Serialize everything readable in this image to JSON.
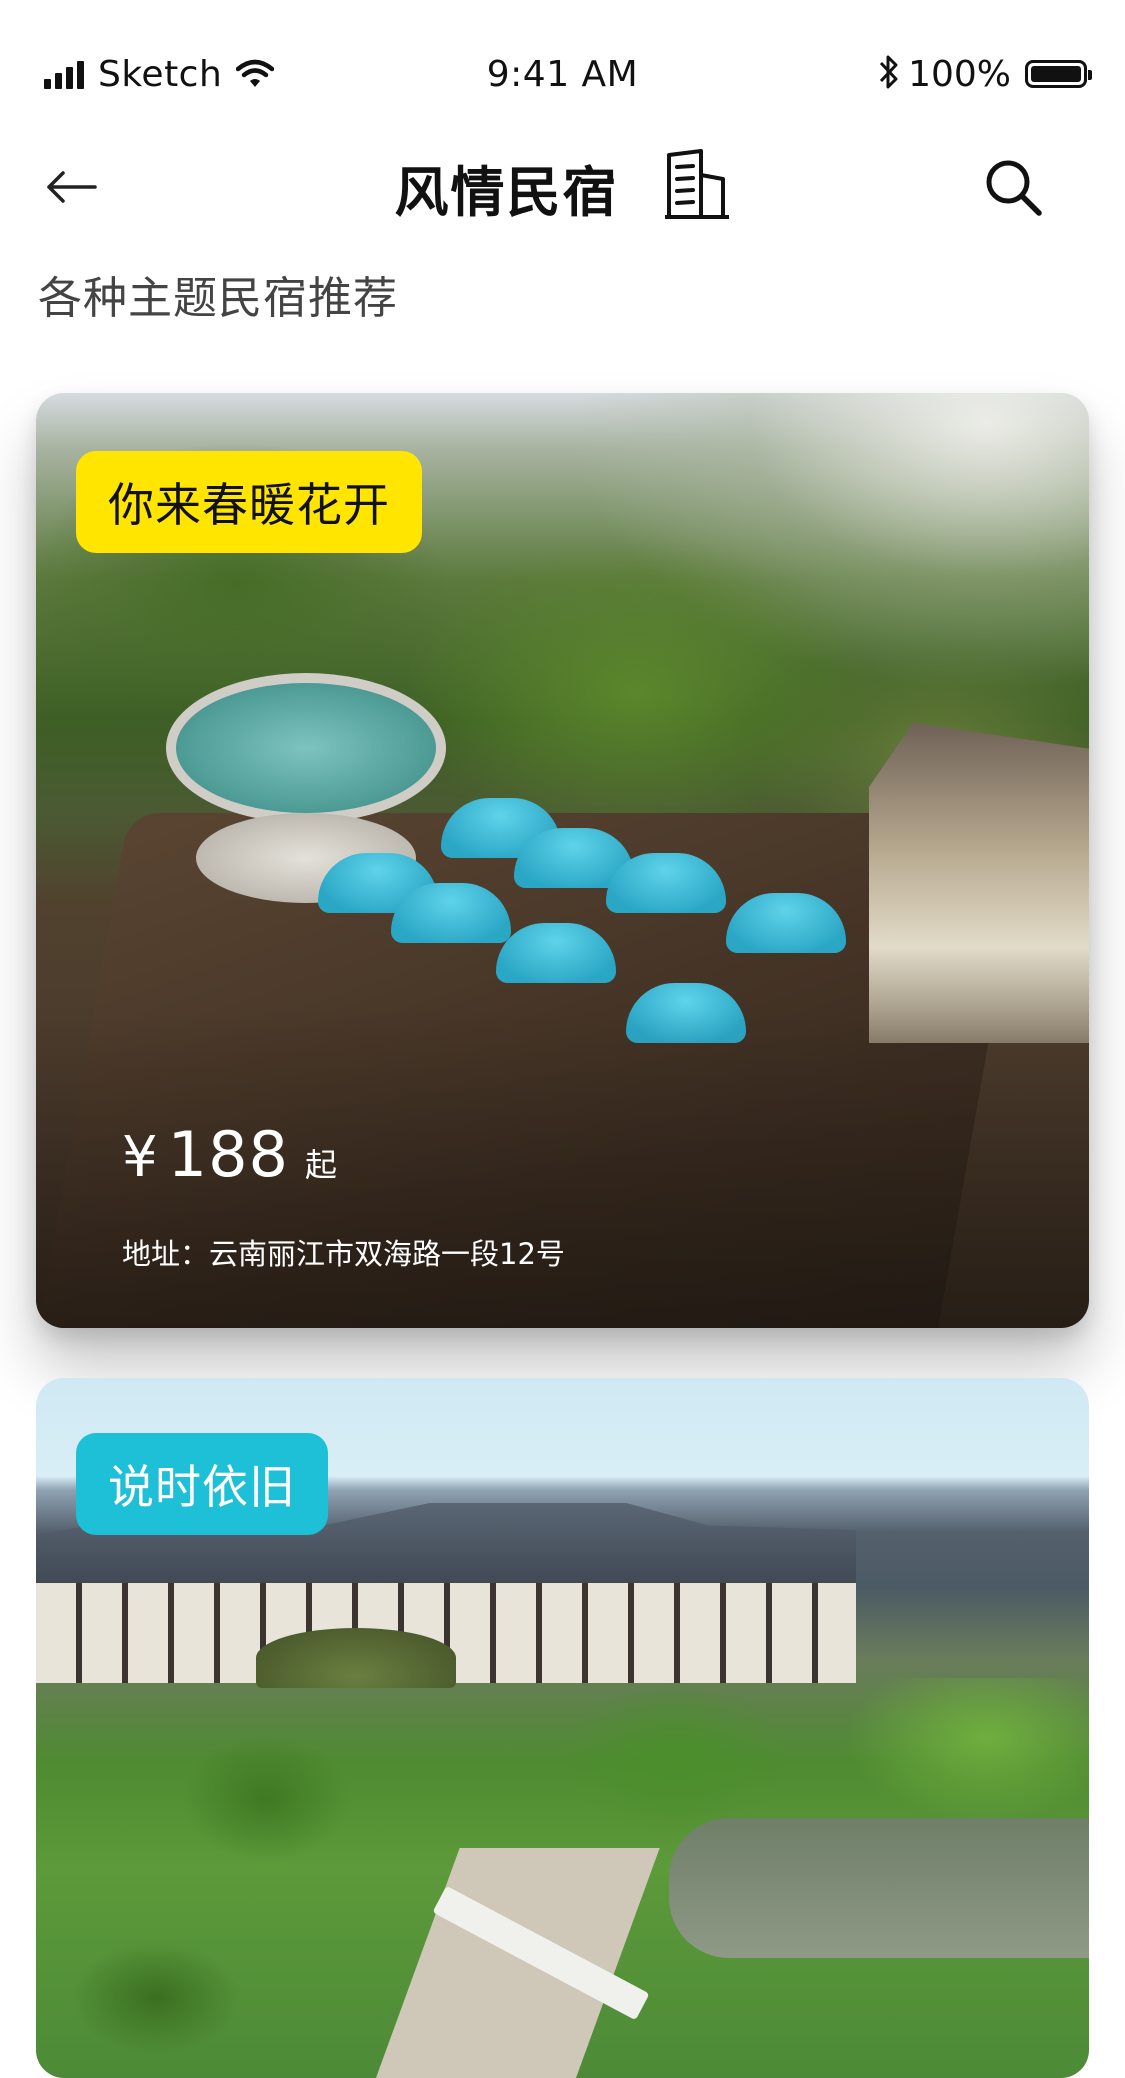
{
  "status_bar": {
    "carrier": "Sketch",
    "time": "9:41 AM",
    "battery": "100%"
  },
  "nav": {
    "title": "风情民宿",
    "icons": [
      "back-arrow-icon",
      "building-icon",
      "search-icon"
    ]
  },
  "section": {
    "subtitle": "各种主题民宿推荐"
  },
  "listings": [
    {
      "tag": "你来春暖花开",
      "tag_color": "#FFE500",
      "price_currency": "¥",
      "price": "188",
      "price_suffix": "起",
      "address": "地址：云南丽江市双海路一段12号"
    },
    {
      "tag": "说时依旧",
      "tag_color": "#1EC0D8"
    }
  ],
  "colors": {
    "accent_yellow": "#FFE500",
    "accent_cyan": "#1EC0D8",
    "text_primary": "#111111",
    "text_secondary": "#444444"
  }
}
